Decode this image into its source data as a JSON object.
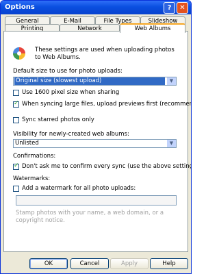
{
  "window": {
    "title": "Options",
    "help_symbol": "?",
    "close_symbol": "✕"
  },
  "tabs": {
    "row_back": [
      "General",
      "E-Mail",
      "File Types",
      "Slideshow"
    ],
    "row_front": [
      "Printing",
      "Network",
      "Web Albums"
    ],
    "active": "Web Albums"
  },
  "content": {
    "intro": "These settings are used when uploading photos to Web Albums.",
    "default_size_label": "Default size to use for photo uploads:",
    "default_size_value": "Original size (slowest upload)",
    "checkboxes": [
      {
        "label": "Use 1600 pixel size when sharing",
        "checked": false
      },
      {
        "label": "When syncing large files, upload previews first (recommended)",
        "checked": true
      },
      {
        "label": "Sync starred photos only",
        "checked": false
      }
    ],
    "visibility_label": "Visibility for newly-created web albums:",
    "visibility_value": "Unlisted",
    "confirmations_label": "Confirmations:",
    "confirm_checkbox": {
      "label": "Don't ask me to confirm every sync (use the above settings)",
      "checked": true
    },
    "watermarks_label": "Watermarks:",
    "watermark_checkbox": {
      "label": "Add a watermark for all photo uploads:",
      "checked": false
    },
    "watermark_value": "",
    "watermark_desc": "Stamp photos with your name, a web domain, or a copyright notice."
  },
  "buttons": {
    "ok": "OK",
    "cancel": "Cancel",
    "apply": "Apply",
    "help": "Help"
  },
  "colors": {
    "titlebar": "#0a4fe0",
    "selection": "#316ac5",
    "tab_accent": "#f5a623"
  }
}
